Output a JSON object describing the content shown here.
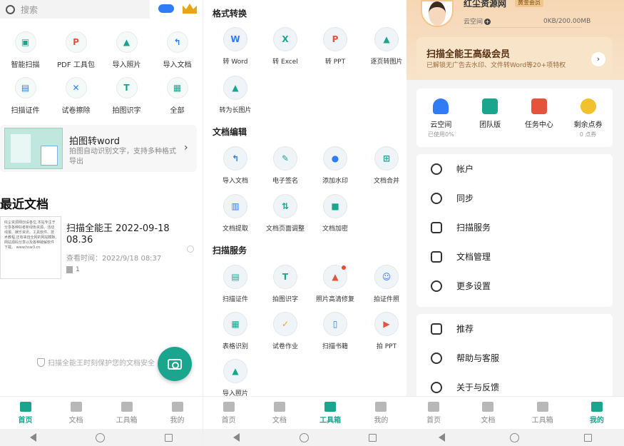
{
  "panel1": {
    "search": {
      "placeholder": "搜索"
    },
    "grid": [
      {
        "label": "智能扫描",
        "icon": "scan-icon",
        "color": "#1aa58e"
      },
      {
        "label": "PDF 工具包",
        "icon": "pdf-icon",
        "color": "#e5533d"
      },
      {
        "label": "导入照片",
        "icon": "photo-icon",
        "color": "#1aa58e"
      },
      {
        "label": "导入文档",
        "icon": "import-doc-icon",
        "color": "#2f7cf6"
      },
      {
        "label": "扫描证件",
        "icon": "id-card-icon",
        "color": "#2f7cf6"
      },
      {
        "label": "试卷擦除",
        "icon": "eraser-icon",
        "color": "#2f7cf6"
      },
      {
        "label": "拍图识字",
        "icon": "text-recognize-icon",
        "color": "#1aa58e"
      },
      {
        "label": "全部",
        "icon": "all-apps-icon",
        "color": "#1aa58e"
      }
    ],
    "promo": {
      "title": "拍图转word",
      "subtitle": "拍图自动识别文字，支持多种格式导出"
    },
    "recent": {
      "heading": "最近文档",
      "thumb_text": "红尘资源网创设各位,本站专注于分享各种好者新绿色资源、活动线报、娱乐资讯、工具软件、技术教程,还有来自全网的网站模板,网站源码分享以及各种破解软件下载。 www.hsw3.cn",
      "title": "扫描全能王 2022-09-18 08.36",
      "view_time": "查看时间：2022/9/18 08:37",
      "pages": "1"
    },
    "safe_text": "扫描全能王时刻保护您的文档安全",
    "tabs": [
      {
        "label": "首页",
        "active": true
      },
      {
        "label": "文档",
        "active": false
      },
      {
        "label": "工具箱",
        "active": false
      },
      {
        "label": "我的",
        "active": false
      }
    ]
  },
  "panel2": {
    "sections": [
      {
        "title": "格式转换",
        "tools": [
          {
            "label": "转 Word",
            "icon": "word-icon",
            "color": "#2f7cf6"
          },
          {
            "label": "转 Excel",
            "icon": "excel-icon",
            "color": "#1aa58e"
          },
          {
            "label": "转 PPT",
            "icon": "ppt-icon",
            "color": "#e5533d"
          },
          {
            "label": "逐页转图片",
            "icon": "page-image-icon",
            "color": "#1aa58e"
          },
          {
            "label": "转为长图片",
            "icon": "long-image-icon",
            "color": "#1aa58e"
          }
        ]
      },
      {
        "title": "文档编辑",
        "tools": [
          {
            "label": "导入文档",
            "icon": "import-doc-icon",
            "color": "#2f7cf6"
          },
          {
            "label": "电子签名",
            "icon": "signature-icon",
            "color": "#1aa58e"
          },
          {
            "label": "添加水印",
            "icon": "watermark-icon",
            "color": "#2f7cf6"
          },
          {
            "label": "文档合并",
            "icon": "merge-icon",
            "color": "#1aa58e"
          },
          {
            "label": "文档提取",
            "icon": "extract-icon",
            "color": "#2f7cf6"
          },
          {
            "label": "文档页面调整",
            "icon": "page-adjust-icon",
            "color": "#1aa58e"
          },
          {
            "label": "文档加密",
            "icon": "lock-icon",
            "color": "#1aa58e"
          }
        ]
      },
      {
        "title": "扫描服务",
        "tools": [
          {
            "label": "扫描证件",
            "icon": "id-card-icon",
            "color": "#1aa58e"
          },
          {
            "label": "拍图识字",
            "icon": "text-recognize-icon",
            "color": "#1aa58e"
          },
          {
            "label": "照片高清修复",
            "icon": "photo-restore-icon",
            "color": "#e5533d"
          },
          {
            "label": "拍证件照",
            "icon": "id-photo-icon",
            "color": "#2f7cf6"
          },
          {
            "label": "表格识别",
            "icon": "table-icon",
            "color": "#1aa58e"
          },
          {
            "label": "试卷作业",
            "icon": "exam-icon",
            "color": "#f0a030"
          },
          {
            "label": "扫描书籍",
            "icon": "book-icon",
            "color": "#2f7cf6"
          },
          {
            "label": "拍 PPT",
            "icon": "ppt-capture-icon",
            "color": "#e5533d"
          },
          {
            "label": "导入照片",
            "icon": "photo-icon",
            "color": "#1aa58e"
          }
        ]
      }
    ],
    "tabs": [
      {
        "label": "首页",
        "active": false
      },
      {
        "label": "文档",
        "active": false
      },
      {
        "label": "工具箱",
        "active": true
      },
      {
        "label": "我的",
        "active": false
      }
    ]
  },
  "panel3": {
    "user": {
      "name": "红尘资源网",
      "badge": "黄金会员",
      "cloud_label": "云空间",
      "plus": "+",
      "usage": "0KB/200.00MB"
    },
    "vip": {
      "title": "扫描全能王高级会员",
      "subtitle": "已解锁无广告去水印、文件转Word等20+项特权",
      "arrow": "›"
    },
    "stats": [
      {
        "label": "云空间",
        "sub": "已使用0%",
        "icon": "cloud-upload-icon",
        "color": "#2f7cf6"
      },
      {
        "label": "团队版",
        "sub": "",
        "icon": "team-icon",
        "color": "#1aa58e"
      },
      {
        "label": "任务中心",
        "sub": "",
        "icon": "task-icon",
        "color": "#e5533d"
      },
      {
        "label": "剩余点券",
        "sub": "0 点券",
        "icon": "coupon-icon",
        "color": "#f2c12e"
      }
    ],
    "menu1": [
      {
        "label": "帐户",
        "icon": "account-icon"
      },
      {
        "label": "同步",
        "icon": "sync-icon"
      },
      {
        "label": "扫描服务",
        "icon": "scan-service-icon"
      },
      {
        "label": "文档管理",
        "icon": "doc-manage-icon"
      },
      {
        "label": "更多设置",
        "icon": "settings-icon"
      }
    ],
    "menu2": [
      {
        "label": "推荐",
        "icon": "thumbs-up-icon"
      },
      {
        "label": "帮助与客服",
        "icon": "help-icon"
      },
      {
        "label": "关于与反馈",
        "icon": "info-icon"
      }
    ],
    "tabs": [
      {
        "label": "首页",
        "active": false
      },
      {
        "label": "文档",
        "active": false
      },
      {
        "label": "工具箱",
        "active": false
      },
      {
        "label": "我的",
        "active": true
      }
    ]
  }
}
